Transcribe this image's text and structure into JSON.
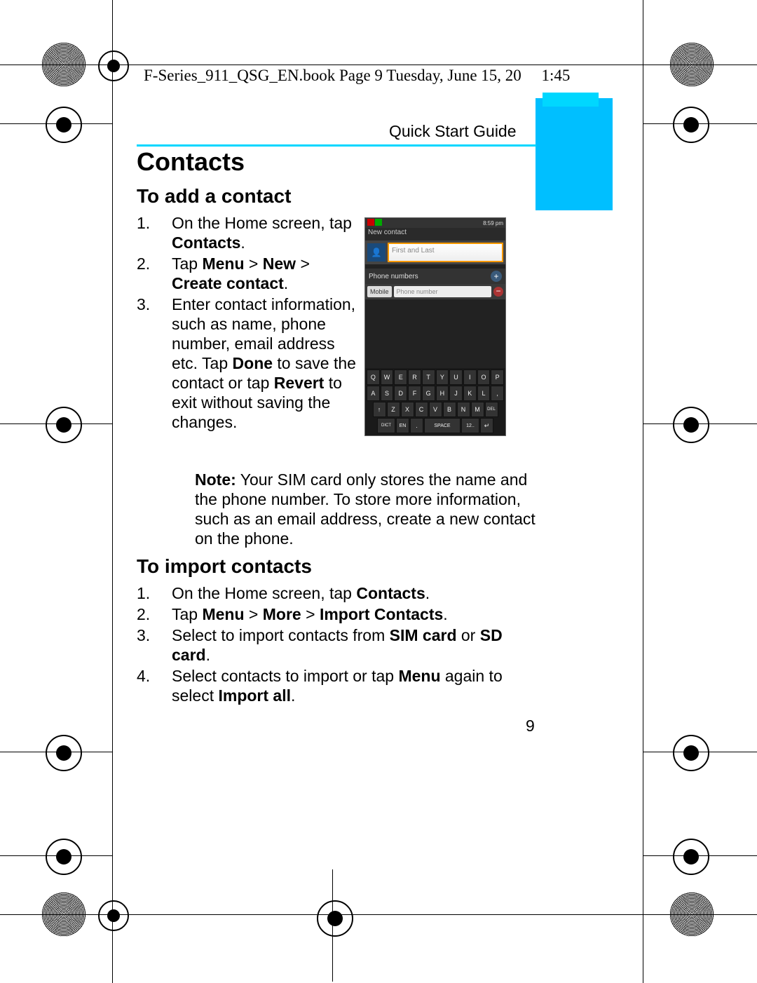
{
  "header_filename": "F-Series_911_QSG_EN.book  Page 9  Tuesday, June 15, 20",
  "header_time_fragment": "1:45",
  "qsg_label": "Quick Start Guide",
  "h1": "Contacts",
  "section_add": {
    "title": "To add a contact",
    "steps": {
      "s1_pre": "On the Home screen, tap ",
      "s1_b1": "Contacts",
      "s1_post": ".",
      "s2_pre": "Tap ",
      "s2_b1": "Menu",
      "s2_mid1": " > ",
      "s2_b2": "New",
      "s2_mid2": " > ",
      "s2_b3": "Create contact",
      "s2_post": ".",
      "s3_pre": "Enter contact information, such as name, phone number, email address etc. Tap ",
      "s3_b1": "Done",
      "s3_mid": " to save the contact or tap ",
      "s3_b2": "Revert",
      "s3_post": " to exit without saving the changes."
    },
    "note_label": "Note:",
    "note_body": " Your SIM card only stores the name and the phone number. To store more information, such as an email address, create a new contact on the phone."
  },
  "section_import": {
    "title": "To import contacts",
    "steps": {
      "s1_pre": "On the Home screen, tap ",
      "s1_b1": "Contacts",
      "s1_post": ".",
      "s2_pre": "Tap ",
      "s2_b1": "Menu",
      "s2_mid1": " > ",
      "s2_b2": "More",
      "s2_mid2": " > ",
      "s2_b3": "Import Contacts",
      "s2_post": ".",
      "s3_pre": "Select to import contacts from ",
      "s3_b1": "SIM card",
      "s3_mid": " or ",
      "s3_b2": "SD card",
      "s3_post": ".",
      "s4_pre": "Select contacts to import or tap ",
      "s4_b1": "Menu",
      "s4_mid": " again to select ",
      "s4_b2": "Import all",
      "s4_post": "."
    }
  },
  "page_number": "9",
  "phone": {
    "time": "8:59 pm",
    "title": "New contact",
    "name_placeholder": "First and Last",
    "phone_section": "Phone numbers",
    "phone_type": "Mobile",
    "phone_placeholder": "Phone number",
    "rows": {
      "r1": [
        "Q",
        "W",
        "E",
        "R",
        "T",
        "Y",
        "U",
        "I",
        "O",
        "P"
      ],
      "r2": [
        "A",
        "S",
        "D",
        "F",
        "G",
        "H",
        "J",
        "K",
        "L",
        ","
      ],
      "r3": [
        "↑",
        "Z",
        "X",
        "C",
        "V",
        "B",
        "N",
        "M",
        "DEL"
      ],
      "r4": [
        "DICT",
        "EN",
        ".",
        "SPACE",
        "12..",
        "↵"
      ]
    }
  }
}
